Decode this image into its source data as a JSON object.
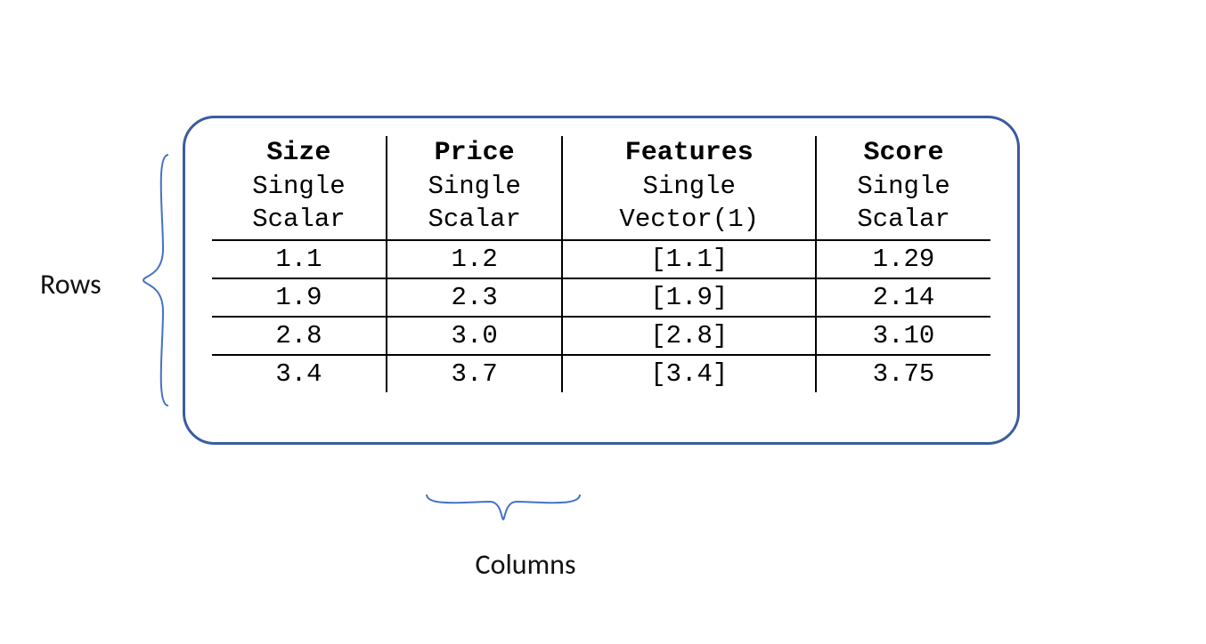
{
  "labels": {
    "rows": "Rows",
    "columns": "Columns"
  },
  "table": {
    "columns": [
      {
        "name": "Size",
        "cardinality": "Single",
        "type": "Scalar"
      },
      {
        "name": "Price",
        "cardinality": "Single",
        "type": "Scalar"
      },
      {
        "name": "Features",
        "cardinality": "Single",
        "type": "Vector(1)"
      },
      {
        "name": "Score",
        "cardinality": "Single",
        "type": "Scalar"
      }
    ],
    "rows": [
      {
        "size": "1.1",
        "price": "1.2",
        "features": "[1.1]",
        "score": "1.29"
      },
      {
        "size": "1.9",
        "price": "2.3",
        "features": "[1.9]",
        "score": "2.14"
      },
      {
        "size": "2.8",
        "price": "3.0",
        "features": "[2.8]",
        "score": "3.10"
      },
      {
        "size": "3.4",
        "price": "3.7",
        "features": "[3.4]",
        "score": "3.75"
      }
    ]
  }
}
